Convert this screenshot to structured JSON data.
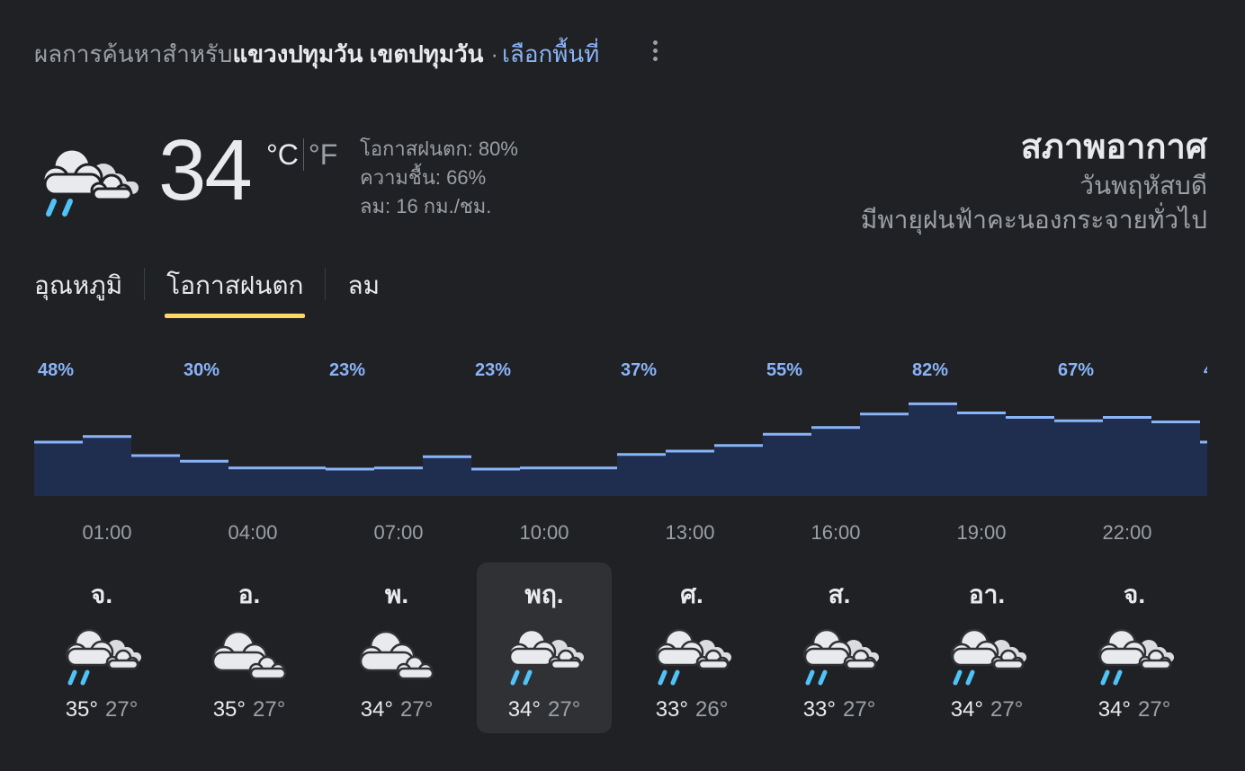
{
  "header": {
    "prefix": "ผลการค้นหาสำหรับ",
    "location": "แขวงปทุมวัน เขตปทุมวัน",
    "separator": "·",
    "choose_area": "เลือกพื้นที่"
  },
  "current": {
    "temperature": "34",
    "unit_c": "°C",
    "unit_f": "°F",
    "precip": "โอกาสฝนตก: 80%",
    "humidity": "ความชื้น: 66%",
    "wind": "ลม: 16 กม./ชม.",
    "icon": "rain-cloud-icon"
  },
  "summary": {
    "title": "สภาพอากาศ",
    "day": "วันพฤหัสบดี",
    "condition": "มีพายุฝนฟ้าคะนองกระจายทั่วไป"
  },
  "tabs": [
    {
      "label": "อุณหภูมิ",
      "active": false
    },
    {
      "label": "โอกาสฝนตก",
      "active": true
    },
    {
      "label": "ลม",
      "active": false
    }
  ],
  "chart_data": {
    "type": "area",
    "hourly_values": [
      48,
      53,
      36,
      31,
      25,
      25,
      24,
      25,
      35,
      24,
      25,
      25,
      37,
      40,
      45,
      55,
      61,
      73,
      82,
      74,
      70,
      67,
      70,
      66,
      48
    ],
    "labels": [
      "48%",
      "30%",
      "23%",
      "23%",
      "37%",
      "55%",
      "82%",
      "67%",
      "4"
    ],
    "ylim": [
      0,
      100
    ],
    "colors": {
      "fill": "#1f2d4f",
      "line": "#8ab4f8",
      "label": "#8ab4f8"
    }
  },
  "times": [
    "01:00",
    "04:00",
    "07:00",
    "10:00",
    "13:00",
    "16:00",
    "19:00",
    "22:00"
  ],
  "days": [
    {
      "name": "จ.",
      "hi": "35°",
      "lo": "27°",
      "icon": "rain-cloud-icon",
      "selected": false
    },
    {
      "name": "อ.",
      "hi": "35°",
      "lo": "27°",
      "icon": "cloud-icon",
      "selected": false
    },
    {
      "name": "พ.",
      "hi": "34°",
      "lo": "27°",
      "icon": "cloud-icon",
      "selected": false
    },
    {
      "name": "พฤ.",
      "hi": "34°",
      "lo": "27°",
      "icon": "rain-cloud-icon",
      "selected": true
    },
    {
      "name": "ศ.",
      "hi": "33°",
      "lo": "26°",
      "icon": "rain-cloud-icon",
      "selected": false
    },
    {
      "name": "ส.",
      "hi": "33°",
      "lo": "27°",
      "icon": "rain-cloud-icon",
      "selected": false
    },
    {
      "name": "อา.",
      "hi": "34°",
      "lo": "27°",
      "icon": "rain-cloud-icon",
      "selected": false
    },
    {
      "name": "จ.",
      "hi": "34°",
      "lo": "27°",
      "icon": "rain-cloud-icon",
      "selected": false
    }
  ]
}
